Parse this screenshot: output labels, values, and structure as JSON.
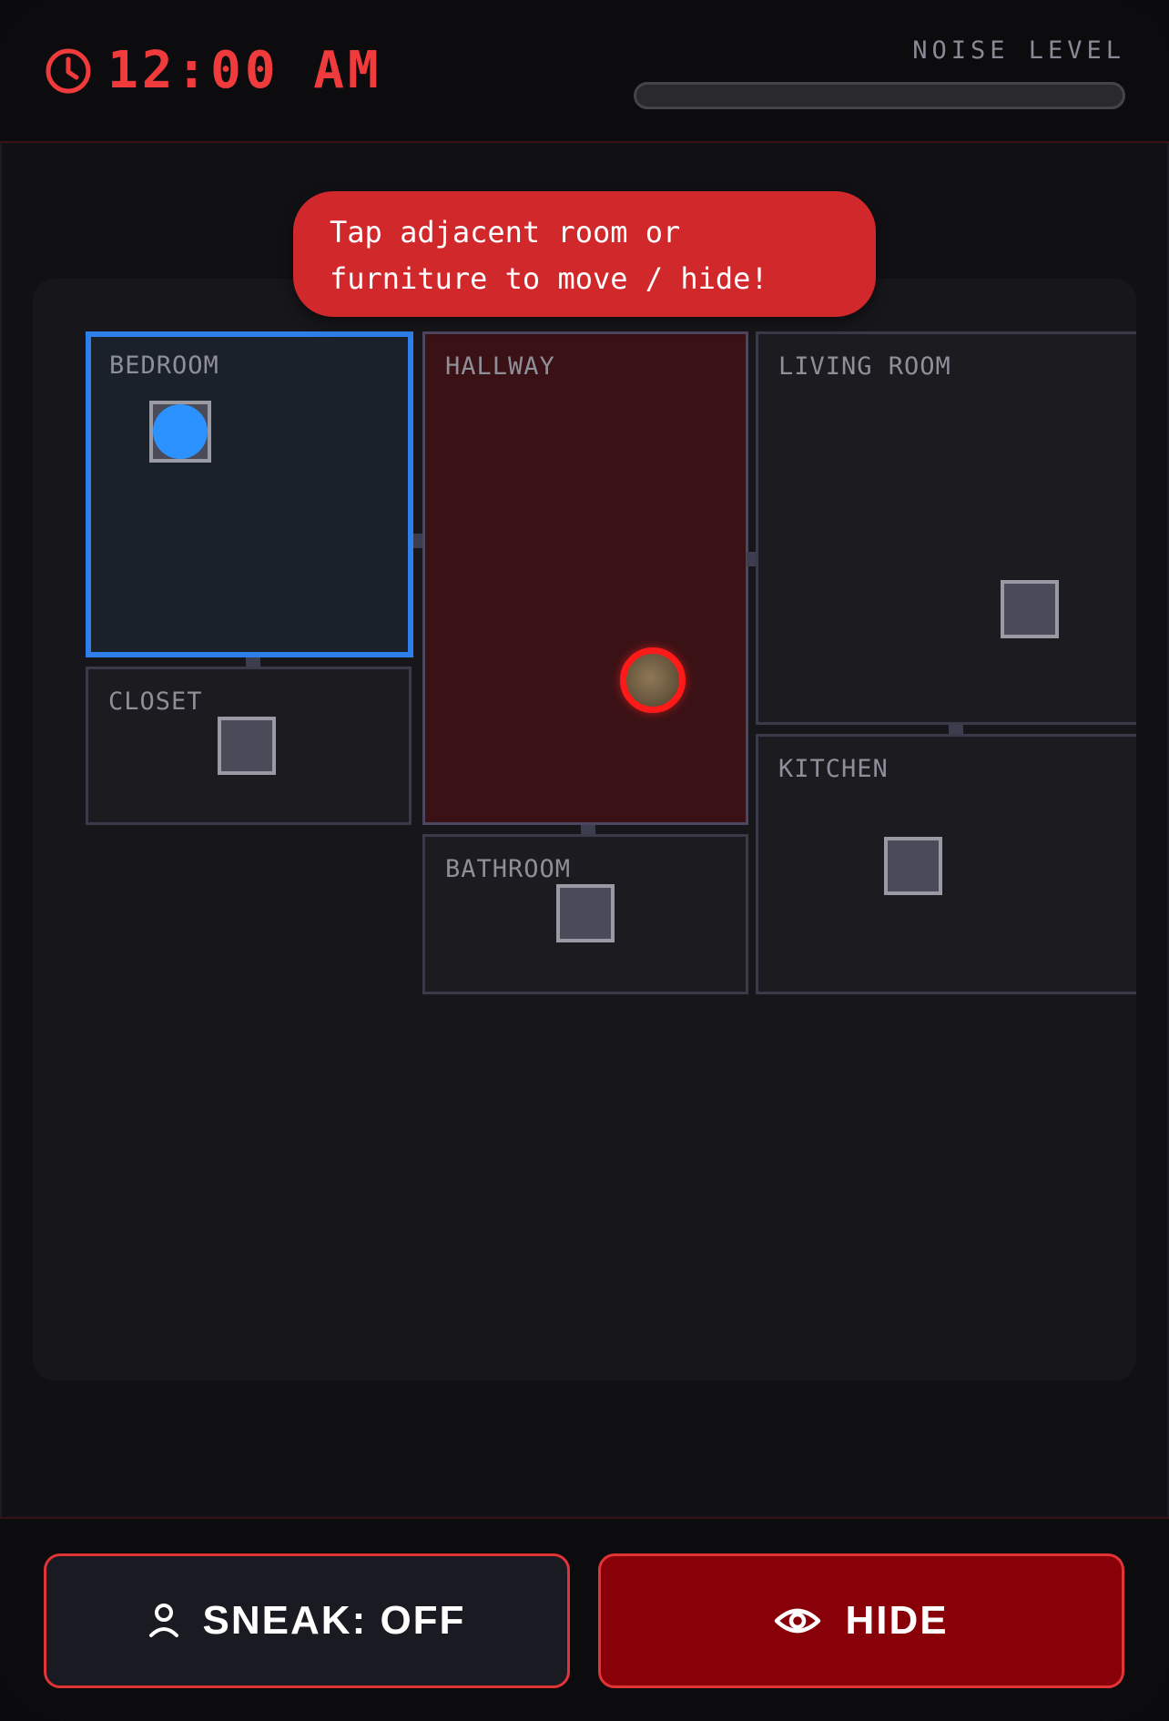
{
  "header": {
    "time": "12:00 AM",
    "clock_icon": "clock-icon",
    "noise_label": "NOISE LEVEL",
    "noise_level": 0
  },
  "hint": {
    "line1": "Tap adjacent room or",
    "line2": "furniture to move / hide!"
  },
  "map": {
    "rooms": {
      "bedroom": "BEDROOM",
      "hallway": "HALLWAY",
      "living_room": "LIVING ROOM",
      "closet": "CLOSET",
      "bathroom": "BATHROOM",
      "kitchen": "KITCHEN"
    },
    "player_room": "BEDROOM",
    "enemy_room": "HALLWAY"
  },
  "footer": {
    "sneak_label": "SNEAK: OFF",
    "sneak_icon": "person-icon",
    "hide_label": "HIDE",
    "hide_icon": "eye-icon"
  },
  "colors": {
    "accent_red": "#ef3b3b",
    "player_blue": "#2b92ff",
    "current_room_border": "#2f7fea",
    "hide_button": "#880008"
  }
}
